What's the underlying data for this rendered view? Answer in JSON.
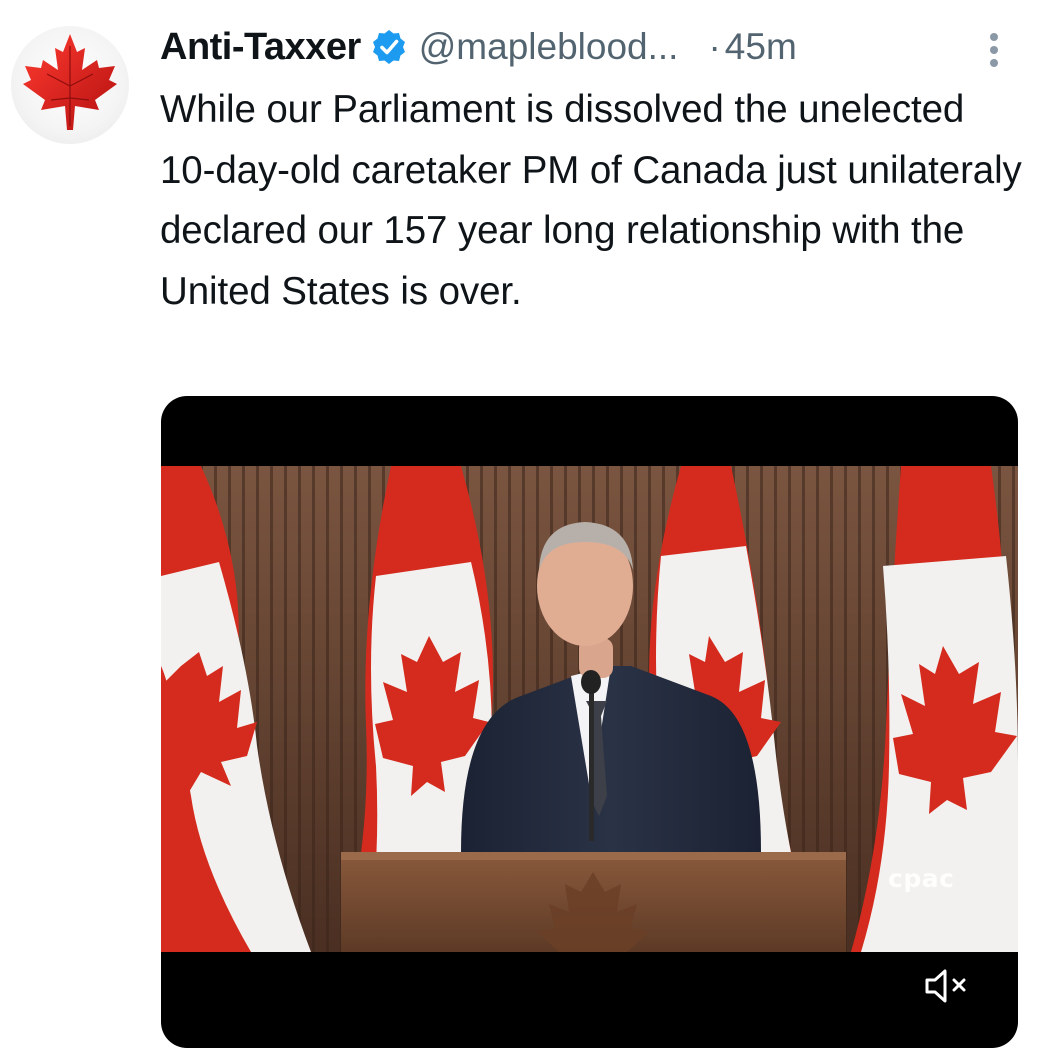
{
  "author": {
    "display_name": "Anti-Taxxer",
    "handle": "@mapleblood...",
    "verified_icon": "verified-badge-icon",
    "avatar_icon": "maple-leaf-icon"
  },
  "meta": {
    "separator": "·",
    "time": "45m"
  },
  "tweet": {
    "text": "While our Parliament is dissolved the unelected 10-day-old caretaker PM of Canada just unilateraly declared our 157 year long relationship with the United States is over."
  },
  "media": {
    "type": "video",
    "watermark": "cpac",
    "controls": {
      "mute_icon": "speaker-muted-icon"
    }
  },
  "colors": {
    "text": "#0f1419",
    "secondary": "#536471",
    "verified": "#1d9bf0",
    "flag_red": "#d52b1e"
  }
}
